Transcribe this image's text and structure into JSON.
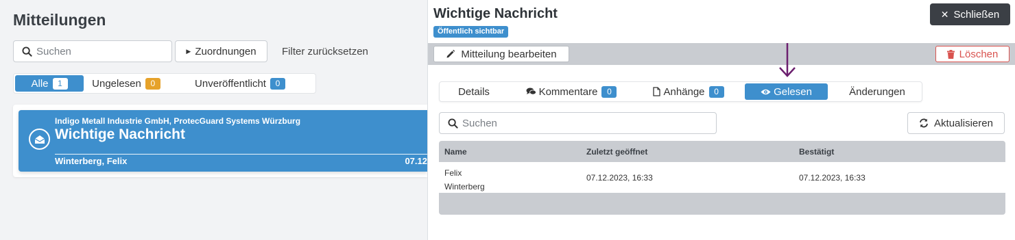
{
  "list": {
    "title": "Mitteilungen",
    "search_placeholder": "Suchen",
    "assign_label": "Zuordnungen",
    "filter_reset_label": "Filter zurücksetzen",
    "filters": [
      {
        "label": "Alle",
        "count": "1"
      },
      {
        "label": "Ungelesen",
        "count": "0"
      },
      {
        "label": "Unveröffentlicht",
        "count": "0"
      }
    ],
    "message": {
      "company": "Indigo Metall Industrie GmbH, ProtecGuard Systems Würzburg",
      "title": "Wichtige Nachricht",
      "author": "Winterberg, Felix",
      "date": "07.12"
    }
  },
  "detail": {
    "title": "Wichtige Nachricht",
    "visibility_badge": "Öffentlich sichtbar",
    "close_label": "Schließen",
    "edit_label": "Mitteilung bearbeiten",
    "delete_label": "Löschen",
    "tabs": [
      {
        "label": "Details"
      },
      {
        "label": "Kommentare",
        "count": "0"
      },
      {
        "label": "Anhänge",
        "count": "0"
      },
      {
        "label": "Gelesen"
      },
      {
        "label": "Änderungen"
      }
    ],
    "search_placeholder": "Suchen",
    "refresh_label": "Aktualisieren",
    "table": {
      "headers": [
        "Name",
        "Zuletzt geöffnet",
        "Bestätigt"
      ],
      "rows": [
        {
          "name_first": "Felix",
          "name_last": "Winterberg",
          "opened": "07.12.2023, 16:33",
          "confirmed": "07.12.2023, 16:33"
        }
      ]
    }
  },
  "colors": {
    "accent": "#3e8fcd",
    "badge_orange": "#e6a22a",
    "danger": "#d9534f",
    "arrow": "#6b1f6e",
    "close_button": "#3b3f45"
  },
  "icons": [
    "search-icon",
    "caret-right-icon",
    "envelope-open-icon",
    "close-icon",
    "pencil-icon",
    "trash-icon",
    "comments-icon",
    "file-icon",
    "eye-icon",
    "refresh-icon",
    "arrow-down-icon"
  ]
}
